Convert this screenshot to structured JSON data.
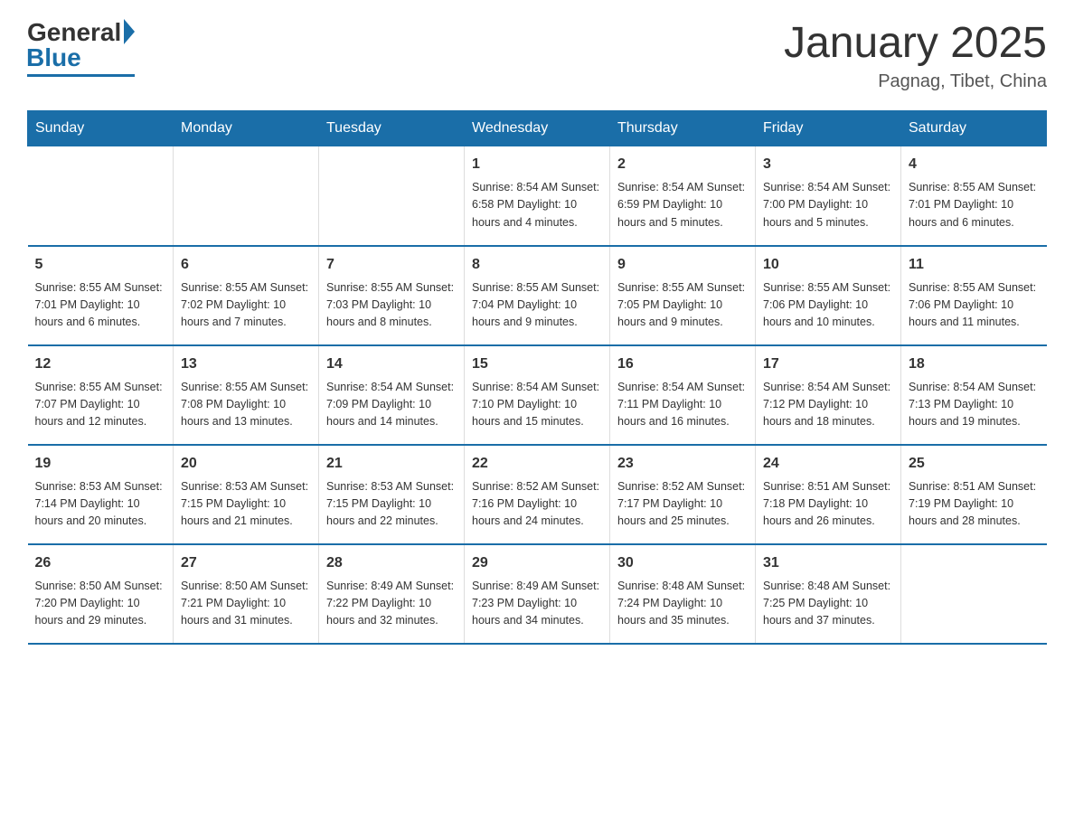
{
  "logo": {
    "general": "General",
    "blue": "Blue"
  },
  "title": "January 2025",
  "subtitle": "Pagnag, Tibet, China",
  "days_of_week": [
    "Sunday",
    "Monday",
    "Tuesday",
    "Wednesday",
    "Thursday",
    "Friday",
    "Saturday"
  ],
  "weeks": [
    {
      "days": [
        {
          "num": "",
          "info": ""
        },
        {
          "num": "",
          "info": ""
        },
        {
          "num": "",
          "info": ""
        },
        {
          "num": "1",
          "info": "Sunrise: 8:54 AM\nSunset: 6:58 PM\nDaylight: 10 hours\nand 4 minutes."
        },
        {
          "num": "2",
          "info": "Sunrise: 8:54 AM\nSunset: 6:59 PM\nDaylight: 10 hours\nand 5 minutes."
        },
        {
          "num": "3",
          "info": "Sunrise: 8:54 AM\nSunset: 7:00 PM\nDaylight: 10 hours\nand 5 minutes."
        },
        {
          "num": "4",
          "info": "Sunrise: 8:55 AM\nSunset: 7:01 PM\nDaylight: 10 hours\nand 6 minutes."
        }
      ]
    },
    {
      "days": [
        {
          "num": "5",
          "info": "Sunrise: 8:55 AM\nSunset: 7:01 PM\nDaylight: 10 hours\nand 6 minutes."
        },
        {
          "num": "6",
          "info": "Sunrise: 8:55 AM\nSunset: 7:02 PM\nDaylight: 10 hours\nand 7 minutes."
        },
        {
          "num": "7",
          "info": "Sunrise: 8:55 AM\nSunset: 7:03 PM\nDaylight: 10 hours\nand 8 minutes."
        },
        {
          "num": "8",
          "info": "Sunrise: 8:55 AM\nSunset: 7:04 PM\nDaylight: 10 hours\nand 9 minutes."
        },
        {
          "num": "9",
          "info": "Sunrise: 8:55 AM\nSunset: 7:05 PM\nDaylight: 10 hours\nand 9 minutes."
        },
        {
          "num": "10",
          "info": "Sunrise: 8:55 AM\nSunset: 7:06 PM\nDaylight: 10 hours\nand 10 minutes."
        },
        {
          "num": "11",
          "info": "Sunrise: 8:55 AM\nSunset: 7:06 PM\nDaylight: 10 hours\nand 11 minutes."
        }
      ]
    },
    {
      "days": [
        {
          "num": "12",
          "info": "Sunrise: 8:55 AM\nSunset: 7:07 PM\nDaylight: 10 hours\nand 12 minutes."
        },
        {
          "num": "13",
          "info": "Sunrise: 8:55 AM\nSunset: 7:08 PM\nDaylight: 10 hours\nand 13 minutes."
        },
        {
          "num": "14",
          "info": "Sunrise: 8:54 AM\nSunset: 7:09 PM\nDaylight: 10 hours\nand 14 minutes."
        },
        {
          "num": "15",
          "info": "Sunrise: 8:54 AM\nSunset: 7:10 PM\nDaylight: 10 hours\nand 15 minutes."
        },
        {
          "num": "16",
          "info": "Sunrise: 8:54 AM\nSunset: 7:11 PM\nDaylight: 10 hours\nand 16 minutes."
        },
        {
          "num": "17",
          "info": "Sunrise: 8:54 AM\nSunset: 7:12 PM\nDaylight: 10 hours\nand 18 minutes."
        },
        {
          "num": "18",
          "info": "Sunrise: 8:54 AM\nSunset: 7:13 PM\nDaylight: 10 hours\nand 19 minutes."
        }
      ]
    },
    {
      "days": [
        {
          "num": "19",
          "info": "Sunrise: 8:53 AM\nSunset: 7:14 PM\nDaylight: 10 hours\nand 20 minutes."
        },
        {
          "num": "20",
          "info": "Sunrise: 8:53 AM\nSunset: 7:15 PM\nDaylight: 10 hours\nand 21 minutes."
        },
        {
          "num": "21",
          "info": "Sunrise: 8:53 AM\nSunset: 7:15 PM\nDaylight: 10 hours\nand 22 minutes."
        },
        {
          "num": "22",
          "info": "Sunrise: 8:52 AM\nSunset: 7:16 PM\nDaylight: 10 hours\nand 24 minutes."
        },
        {
          "num": "23",
          "info": "Sunrise: 8:52 AM\nSunset: 7:17 PM\nDaylight: 10 hours\nand 25 minutes."
        },
        {
          "num": "24",
          "info": "Sunrise: 8:51 AM\nSunset: 7:18 PM\nDaylight: 10 hours\nand 26 minutes."
        },
        {
          "num": "25",
          "info": "Sunrise: 8:51 AM\nSunset: 7:19 PM\nDaylight: 10 hours\nand 28 minutes."
        }
      ]
    },
    {
      "days": [
        {
          "num": "26",
          "info": "Sunrise: 8:50 AM\nSunset: 7:20 PM\nDaylight: 10 hours\nand 29 minutes."
        },
        {
          "num": "27",
          "info": "Sunrise: 8:50 AM\nSunset: 7:21 PM\nDaylight: 10 hours\nand 31 minutes."
        },
        {
          "num": "28",
          "info": "Sunrise: 8:49 AM\nSunset: 7:22 PM\nDaylight: 10 hours\nand 32 minutes."
        },
        {
          "num": "29",
          "info": "Sunrise: 8:49 AM\nSunset: 7:23 PM\nDaylight: 10 hours\nand 34 minutes."
        },
        {
          "num": "30",
          "info": "Sunrise: 8:48 AM\nSunset: 7:24 PM\nDaylight: 10 hours\nand 35 minutes."
        },
        {
          "num": "31",
          "info": "Sunrise: 8:48 AM\nSunset: 7:25 PM\nDaylight: 10 hours\nand 37 minutes."
        },
        {
          "num": "",
          "info": ""
        }
      ]
    }
  ]
}
